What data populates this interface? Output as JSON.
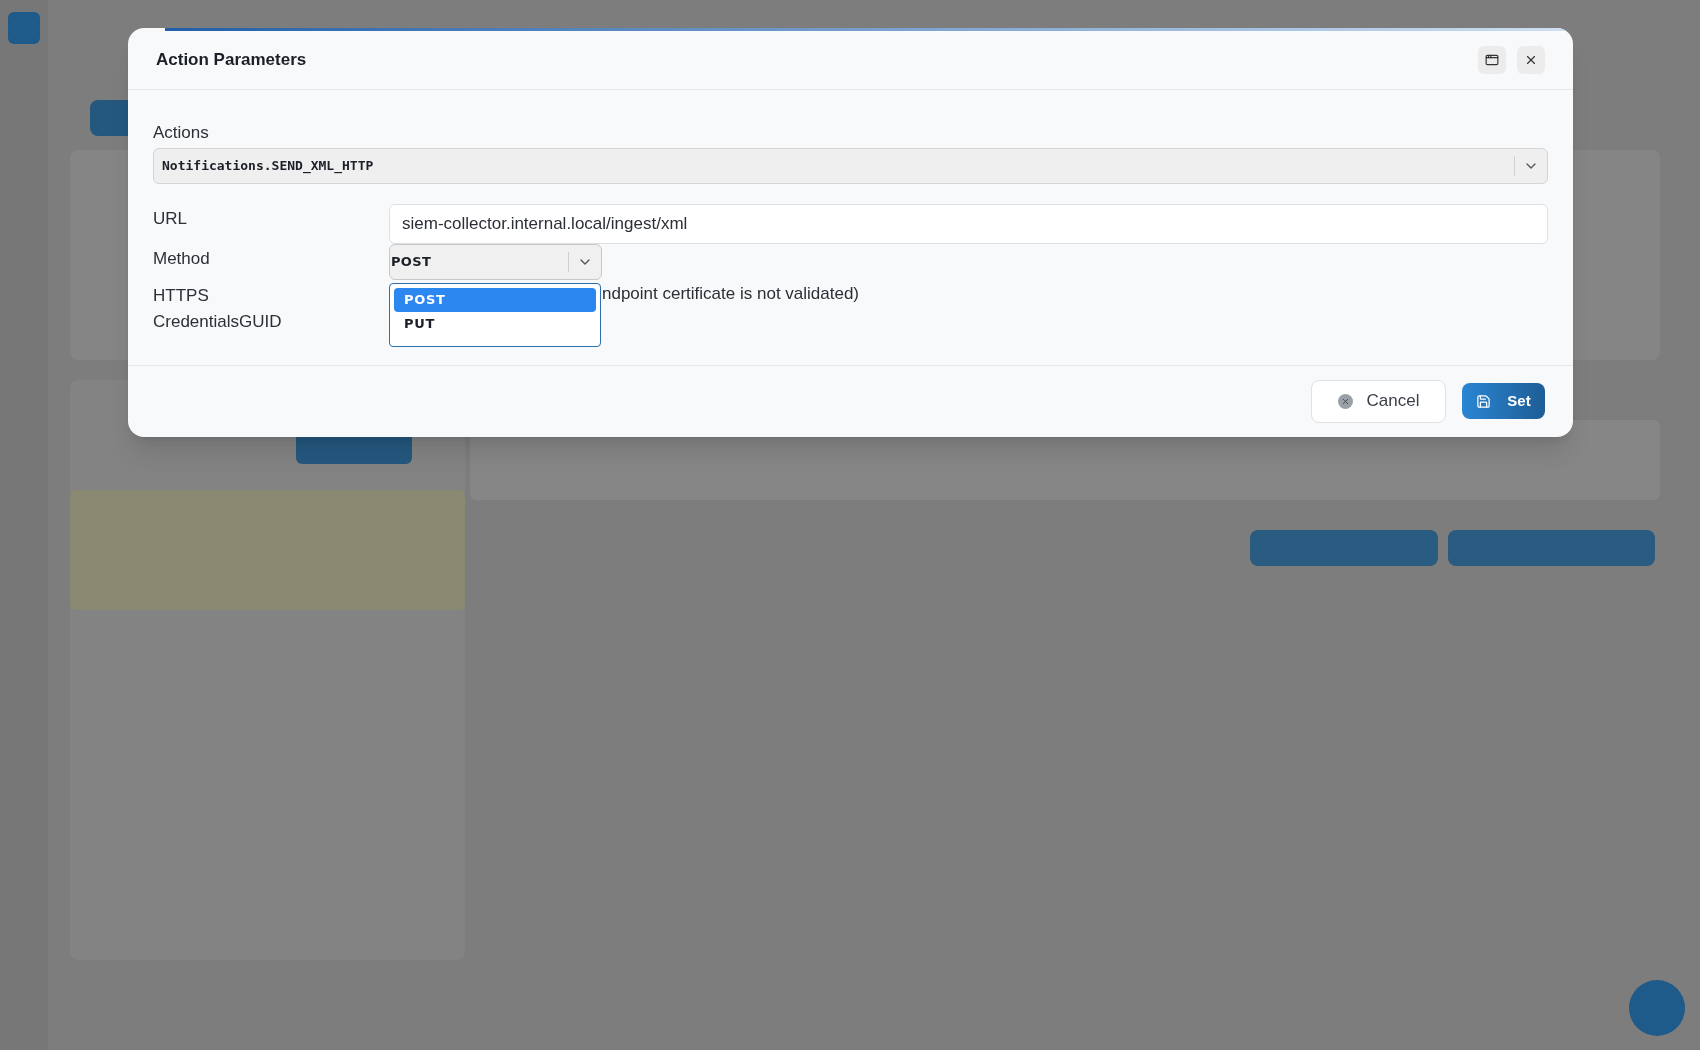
{
  "dialog": {
    "title": "Action Parameters",
    "actions": {
      "label": "Actions",
      "value": "Notifications.SEND_XML_HTTP"
    },
    "fields": [
      {
        "kind": "text",
        "label": "URL",
        "value": "siem-collector.internal.local/ingest/xml"
      },
      {
        "kind": "select",
        "label": "Method",
        "value": "POST",
        "expanded": true,
        "options": [
          {
            "label": "POST",
            "selected": true
          },
          {
            "label": "PUT",
            "selected": false
          }
        ]
      },
      {
        "kind": "note",
        "label": "HTTPS",
        "text": "ndpoint certificate is not validated)"
      },
      {
        "kind": "empty",
        "label": "CredentialsGUID"
      }
    ],
    "buttons": [
      {
        "kind": "cancel",
        "label": "Cancel"
      },
      {
        "kind": "primary",
        "label": "Set"
      }
    ]
  }
}
